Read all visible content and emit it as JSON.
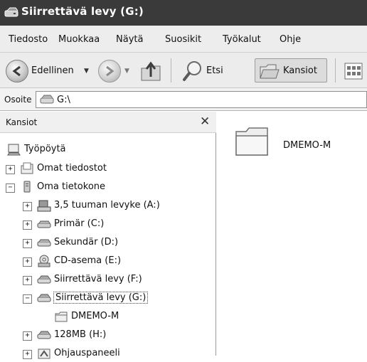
{
  "window": {
    "title": "Siirrettävä levy (G:)"
  },
  "menu": {
    "items": [
      "Tiedosto",
      "Muokkaa",
      "Näytä",
      "Suosikit",
      "Työkalut",
      "Ohje"
    ]
  },
  "toolbar": {
    "back_label": "Edellinen",
    "search_label": "Etsi",
    "folders_label": "Kansiot"
  },
  "address": {
    "label": "Osoite",
    "value": "G:\\"
  },
  "folders_pane": {
    "title": "Kansiot",
    "close_glyph": "✕",
    "tree": [
      {
        "label": "Työpöytä",
        "icon": "desktop-icon",
        "expander": ""
      },
      {
        "label": "Omat tiedostot",
        "icon": "documents-icon",
        "expander": "+"
      },
      {
        "label": "Oma tietokone",
        "icon": "computer-icon",
        "expander": "−"
      },
      {
        "label": "3,5 tuuman levyke (A:)",
        "icon": "floppy-icon",
        "expander": "+"
      },
      {
        "label": "Primär (C:)",
        "icon": "drive-icon",
        "expander": "+"
      },
      {
        "label": "Sekundär (D:)",
        "icon": "drive-icon",
        "expander": "+"
      },
      {
        "label": "CD-asema (E:)",
        "icon": "cd-drive-icon",
        "expander": "+"
      },
      {
        "label": "Siirrettävä levy (F:)",
        "icon": "removable-drive-icon",
        "expander": "+"
      },
      {
        "label": "Siirrettävä levy (G:)",
        "icon": "removable-drive-icon",
        "expander": "−",
        "selected": true
      },
      {
        "label": "DMEMO-M",
        "icon": "folder-icon",
        "expander": ""
      },
      {
        "label": "128MB (H:)",
        "icon": "removable-drive-icon",
        "expander": "+"
      },
      {
        "label": "Ohjauspaneeli",
        "icon": "control-panel-icon",
        "expander": "+"
      }
    ]
  },
  "content": {
    "items": [
      {
        "label": "DMEMO-M",
        "icon": "folder-icon"
      }
    ]
  }
}
